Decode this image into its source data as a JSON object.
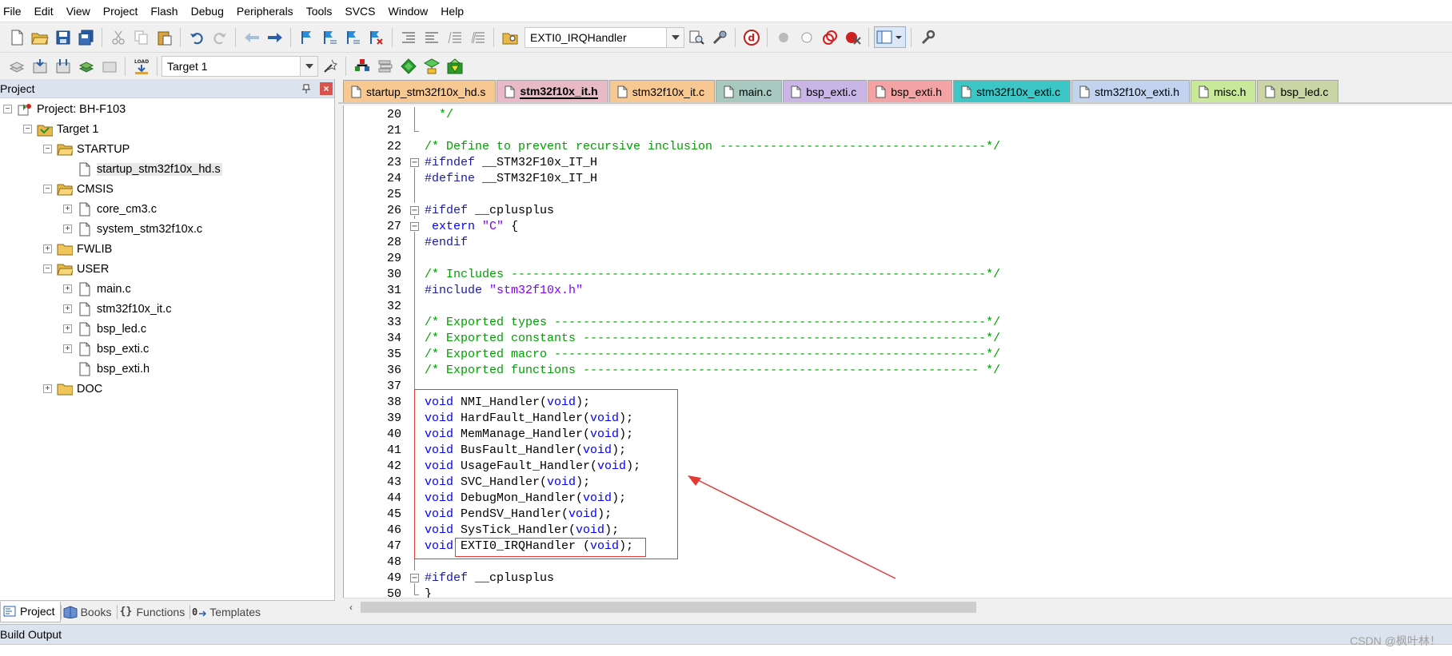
{
  "menu": [
    "File",
    "Edit",
    "View",
    "Project",
    "Flash",
    "Debug",
    "Peripherals",
    "Tools",
    "SVCS",
    "Window",
    "Help"
  ],
  "toolbar": {
    "function_dropdown_value": "EXTI0_IRQHandler",
    "target_dropdown_value": "Target 1"
  },
  "project_panel": {
    "title": "Project",
    "tree": [
      {
        "label": "Project: BH-F103",
        "depth": 0,
        "expander": "−",
        "icon": "project-icon"
      },
      {
        "label": "Target 1",
        "depth": 1,
        "expander": "−",
        "icon": "target-icon"
      },
      {
        "label": "STARTUP",
        "depth": 2,
        "expander": "−",
        "icon": "folder-open-icon"
      },
      {
        "label": "startup_stm32f10x_hd.s",
        "depth": 3,
        "expander": "",
        "icon": "file-icon",
        "selected": true
      },
      {
        "label": "CMSIS",
        "depth": 2,
        "expander": "−",
        "icon": "folder-open-icon"
      },
      {
        "label": "core_cm3.c",
        "depth": 3,
        "expander": "+",
        "icon": "file-icon"
      },
      {
        "label": "system_stm32f10x.c",
        "depth": 3,
        "expander": "+",
        "icon": "file-icon"
      },
      {
        "label": "FWLIB",
        "depth": 2,
        "expander": "+",
        "icon": "folder-icon"
      },
      {
        "label": "USER",
        "depth": 2,
        "expander": "−",
        "icon": "folder-open-icon"
      },
      {
        "label": "main.c",
        "depth": 3,
        "expander": "+",
        "icon": "file-icon"
      },
      {
        "label": "stm32f10x_it.c",
        "depth": 3,
        "expander": "+",
        "icon": "file-icon"
      },
      {
        "label": "bsp_led.c",
        "depth": 3,
        "expander": "+",
        "icon": "file-icon"
      },
      {
        "label": "bsp_exti.c",
        "depth": 3,
        "expander": "+",
        "icon": "file-icon"
      },
      {
        "label": "bsp_exti.h",
        "depth": 3,
        "expander": "",
        "icon": "file-icon"
      },
      {
        "label": "DOC",
        "depth": 2,
        "expander": "+",
        "icon": "folder-icon"
      }
    ],
    "bottom_tabs": [
      {
        "label": "Project",
        "icon": "project-tab-icon",
        "active": true
      },
      {
        "label": "Books",
        "icon": "books-icon",
        "active": false
      },
      {
        "label": "Functions",
        "icon": "braces-icon",
        "active": false
      },
      {
        "label": "Templates",
        "icon": "templates-icon",
        "active": false
      }
    ]
  },
  "file_tabs": [
    {
      "label": "startup_stm32f10x_hd.s",
      "color": "#f7c891",
      "active": false
    },
    {
      "label": "stm32f10x_it.h",
      "color": "#e8b9c7",
      "active": true
    },
    {
      "label": "stm32f10x_it.c",
      "color": "#f7c891",
      "active": false
    },
    {
      "label": "main.c",
      "color": "#a7c9c0",
      "active": false
    },
    {
      "label": "bsp_exti.c",
      "color": "#c9b6e6",
      "active": false
    },
    {
      "label": "bsp_exti.h",
      "color": "#f3a3a3",
      "active": false
    },
    {
      "label": "stm32f10x_exti.c",
      "color": "#3cc6c6",
      "active": false
    },
    {
      "label": "stm32f10x_exti.h",
      "color": "#c2d3f0",
      "active": false
    },
    {
      "label": "misc.h",
      "color": "#c8e89a",
      "active": false
    },
    {
      "label": "bsp_led.c",
      "color": "#c9d5a4",
      "active": false
    }
  ],
  "code_lines": [
    {
      "n": "20",
      "fold": "bar",
      "tokens": [
        [
          "green",
          "  */"
        ]
      ]
    },
    {
      "n": "21",
      "fold": "end",
      "tokens": []
    },
    {
      "n": "22",
      "fold": "",
      "tokens": [
        [
          "green",
          "/* Define to prevent recursive inclusion -------------------------------------*/"
        ]
      ]
    },
    {
      "n": "23",
      "fold": "open",
      "tokens": [
        [
          "navy",
          "#ifndef"
        ],
        [
          "black",
          " __STM32F10x_IT_H"
        ]
      ]
    },
    {
      "n": "24",
      "fold": "bar",
      "tokens": [
        [
          "navy",
          "#define"
        ],
        [
          "black",
          " __STM32F10x_IT_H"
        ]
      ]
    },
    {
      "n": "25",
      "fold": "bar",
      "tokens": []
    },
    {
      "n": "26",
      "fold": "open",
      "tokens": [
        [
          "navy",
          "#ifdef"
        ],
        [
          "black",
          " __cplusplus"
        ]
      ]
    },
    {
      "n": "27",
      "fold": "open",
      "tokens": [
        [
          "black",
          " "
        ],
        [
          "blue",
          "extern"
        ],
        [
          "black",
          " "
        ],
        [
          "purple",
          "\"C\""
        ],
        [
          "black",
          " {"
        ]
      ]
    },
    {
      "n": "28",
      "fold": "bar",
      "tokens": [
        [
          "navy",
          "#endif"
        ]
      ]
    },
    {
      "n": "29",
      "fold": "bar",
      "tokens": []
    },
    {
      "n": "30",
      "fold": "bar",
      "tokens": [
        [
          "green",
          "/* Includes ------------------------------------------------------------------*/"
        ]
      ]
    },
    {
      "n": "31",
      "fold": "bar",
      "tokens": [
        [
          "navy",
          "#include"
        ],
        [
          "black",
          " "
        ],
        [
          "purple",
          "\"stm32f10x.h\""
        ]
      ]
    },
    {
      "n": "32",
      "fold": "bar",
      "tokens": []
    },
    {
      "n": "33",
      "fold": "bar",
      "tokens": [
        [
          "green",
          "/* Exported types ------------------------------------------------------------*/"
        ]
      ]
    },
    {
      "n": "34",
      "fold": "bar",
      "tokens": [
        [
          "green",
          "/* Exported constants --------------------------------------------------------*/"
        ]
      ]
    },
    {
      "n": "35",
      "fold": "bar",
      "tokens": [
        [
          "green",
          "/* Exported macro ------------------------------------------------------------*/"
        ]
      ]
    },
    {
      "n": "36",
      "fold": "bar",
      "tokens": [
        [
          "green",
          "/* Exported functions ------------------------------------------------------- */"
        ]
      ]
    },
    {
      "n": "37",
      "fold": "bar",
      "tokens": []
    },
    {
      "n": "38",
      "fold": "bar",
      "tokens": [
        [
          "blue",
          "void"
        ],
        [
          "black",
          " NMI_Handler("
        ],
        [
          "blue",
          "void"
        ],
        [
          "black",
          ");"
        ]
      ]
    },
    {
      "n": "39",
      "fold": "bar",
      "tokens": [
        [
          "blue",
          "void"
        ],
        [
          "black",
          " HardFault_Handler("
        ],
        [
          "blue",
          "void"
        ],
        [
          "black",
          ");"
        ]
      ]
    },
    {
      "n": "40",
      "fold": "bar",
      "tokens": [
        [
          "blue",
          "void"
        ],
        [
          "black",
          " MemManage_Handler("
        ],
        [
          "blue",
          "void"
        ],
        [
          "black",
          ");"
        ]
      ]
    },
    {
      "n": "41",
      "fold": "bar",
      "tokens": [
        [
          "blue",
          "void"
        ],
        [
          "black",
          " BusFault_Handler("
        ],
        [
          "blue",
          "void"
        ],
        [
          "black",
          ");"
        ]
      ]
    },
    {
      "n": "42",
      "fold": "bar",
      "tokens": [
        [
          "blue",
          "void"
        ],
        [
          "black",
          " UsageFault_Handler("
        ],
        [
          "blue",
          "void"
        ],
        [
          "black",
          ");"
        ]
      ]
    },
    {
      "n": "43",
      "fold": "bar",
      "tokens": [
        [
          "blue",
          "void"
        ],
        [
          "black",
          " SVC_Handler("
        ],
        [
          "blue",
          "void"
        ],
        [
          "black",
          ");"
        ]
      ]
    },
    {
      "n": "44",
      "fold": "bar",
      "tokens": [
        [
          "blue",
          "void"
        ],
        [
          "black",
          " DebugMon_Handler("
        ],
        [
          "blue",
          "void"
        ],
        [
          "black",
          ");"
        ]
      ]
    },
    {
      "n": "45",
      "fold": "bar",
      "tokens": [
        [
          "blue",
          "void"
        ],
        [
          "black",
          " PendSV_Handler("
        ],
        [
          "blue",
          "void"
        ],
        [
          "black",
          ");"
        ]
      ]
    },
    {
      "n": "46",
      "fold": "bar",
      "tokens": [
        [
          "blue",
          "void"
        ],
        [
          "black",
          " SysTick_Handler("
        ],
        [
          "blue",
          "void"
        ],
        [
          "black",
          ");"
        ]
      ]
    },
    {
      "n": "47",
      "fold": "bar",
      "tokens": [
        [
          "blue",
          "void"
        ],
        [
          "black",
          " EXTI0_IRQHandler ("
        ],
        [
          "blue",
          "void"
        ],
        [
          "black",
          ");"
        ]
      ]
    },
    {
      "n": "48",
      "fold": "bar",
      "tokens": []
    },
    {
      "n": "49",
      "fold": "open",
      "tokens": [
        [
          "navy",
          "#ifdef"
        ],
        [
          "black",
          " __cplusplus"
        ]
      ]
    },
    {
      "n": "50",
      "fold": "end",
      "tokens": [
        [
          "black",
          "}"
        ]
      ]
    }
  ],
  "build_output": {
    "title": "Build Output"
  },
  "watermark": "CSDN @枫叶林！",
  "colors": {
    "comment": "#00a000",
    "keyword": "#0000ff",
    "preprocessor": "#1a1aa6",
    "string": "#8000ff",
    "annotation": "#e53935"
  }
}
